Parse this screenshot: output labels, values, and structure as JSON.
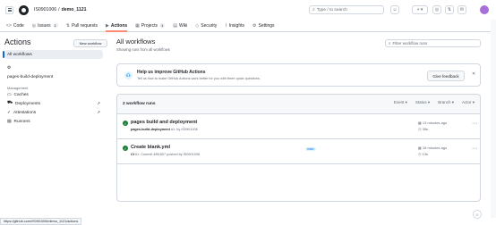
{
  "header": {
    "owner": "IS0901006",
    "sep": "/",
    "repo": "demo_1121",
    "search_placeholder": "Type / to search",
    "kbd": "/"
  },
  "nav": [
    {
      "label": "Code",
      "icon": "<>"
    },
    {
      "label": "Issues",
      "count": "1",
      "icon": "◎"
    },
    {
      "label": "Pull requests",
      "icon": "⇅"
    },
    {
      "label": "Actions",
      "icon": "▶"
    },
    {
      "label": "Projects",
      "count": "1",
      "icon": "▦"
    },
    {
      "label": "Wiki",
      "icon": "▤"
    },
    {
      "label": "Security",
      "icon": "◇"
    },
    {
      "label": "Insights",
      "icon": "⌇"
    },
    {
      "label": "Settings",
      "icon": "⚙"
    }
  ],
  "sidebar": {
    "title": "Actions",
    "new_workflow": "New workflow",
    "all_workflows": "All workflows",
    "workflow": "pages-build-deployment",
    "manage_heading": "Management",
    "items": [
      {
        "label": "Caches",
        "icon": "▭"
      },
      {
        "label": "Deployments",
        "icon": "⛟",
        "ext": "↗"
      },
      {
        "label": "Attestations",
        "icon": "✓",
        "ext": "↗"
      },
      {
        "label": "Runners",
        "icon": "▤"
      }
    ]
  },
  "main": {
    "title": "All workflows",
    "subtitle": "Showing runs from all workflows",
    "filter_placeholder": "Filter workflow runs",
    "banner": {
      "title": "Help us improve GitHub Actions",
      "text": "Tell us how to make GitHub Actions work better for you with three quick questions.",
      "button": "Give feedback"
    },
    "runs_count": "2 workflow runs",
    "filters": [
      "Event",
      "Status",
      "Branch",
      "Actor"
    ],
    "runs": [
      {
        "title": "pages build and deployment",
        "meta_bold": "pages-build-deployment",
        "meta": " #1: by IS0901006",
        "badge": "",
        "time": "13 minutes ago",
        "duration": "35s"
      },
      {
        "title": "Create blank.yml",
        "meta_bold": "CI",
        "meta": " #1: Commit 4f81807 pushed by IS0901006",
        "badge": "main",
        "time": "18 minutes ago",
        "duration": "13s"
      }
    ]
  },
  "status_url": "https://github.com/IS0901006/demo_1121/actions"
}
